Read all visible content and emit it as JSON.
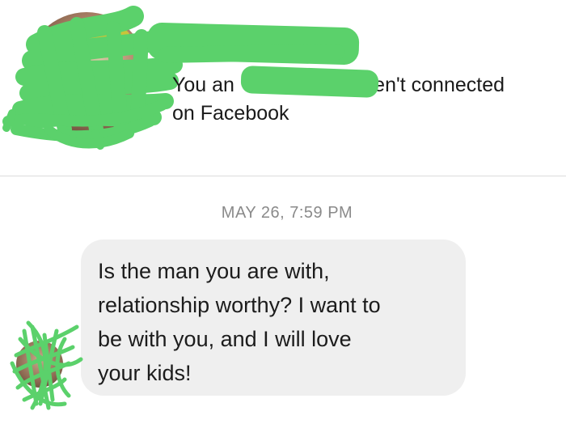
{
  "header": {
    "profile_avatar_icon": "profile-photo-redacted",
    "connection_line1_part1": "You an",
    "connection_line1_part2": "aren't connected",
    "connection_line2": "on Facebook"
  },
  "thread": {
    "timestamp": "MAY 26, 7:59 PM",
    "message": {
      "line1": "Is the man you are with,",
      "line2": "relationship worthy?  I want to",
      "line3": "be with you, and I will love",
      "line4": "your kids!"
    },
    "sender_avatar_icon": "sender-photo-redacted"
  },
  "colors": {
    "redaction": "#5bd16b",
    "bubble": "#efefef",
    "timestamp": "#8a8a8a",
    "text": "#1a1a1a"
  }
}
